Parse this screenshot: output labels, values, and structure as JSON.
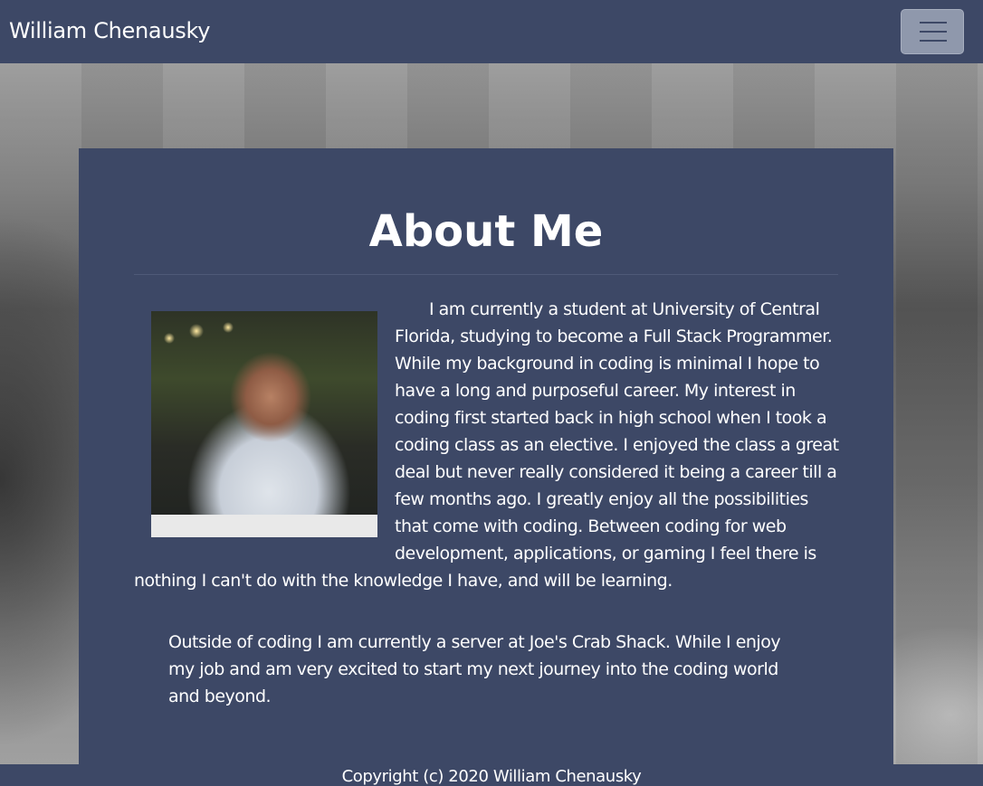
{
  "navbar": {
    "brand": "William Chenausky",
    "menu_icon": "hamburger-menu-icon"
  },
  "about": {
    "title": "About Me",
    "photo_icon": "profile-photo",
    "paragraph1": "I am currently a student at University of Central Florida, studying to become a Full Stack Programmer. While my background in coding is minimal I hope to have a long and purposeful career. My interest in coding first started back in high school when I took a coding class as an elective. I enjoyed the class a great deal but never really considered it being a career till a few months ago. I greatly enjoy all the possibilities that come with coding. Between coding for web development, applications, or gaming I feel there is nothing I can't do with the knowledge I have, and will be learning.",
    "paragraph2": "Outside of coding I am currently a server at Joe's Crab Shack. While I enjoy my job and am very excited to start my next journey into the coding world and beyond."
  },
  "footer": {
    "copyright": "Copyright (c) 2020 William Chenausky"
  },
  "colors": {
    "navbar_bg": "#3d4866",
    "card_bg": "#3d4866",
    "toggler_bg": "#8f98ac",
    "text": "#ffffff"
  }
}
